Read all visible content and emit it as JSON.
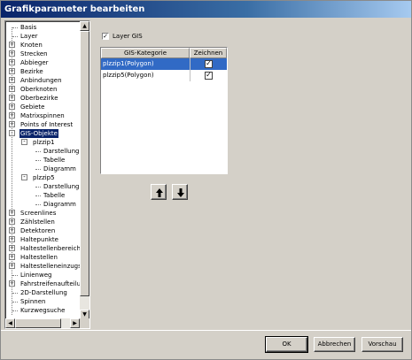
{
  "window": {
    "title": "Grafikparameter bearbeiten"
  },
  "tree": {
    "items": [
      {
        "label": "Basis",
        "level": 0,
        "toggle": ""
      },
      {
        "label": "Layer",
        "level": 0,
        "toggle": ""
      },
      {
        "label": "Knoten",
        "level": 0,
        "toggle": "+"
      },
      {
        "label": "Strecken",
        "level": 0,
        "toggle": "+"
      },
      {
        "label": "Abbieger",
        "level": 0,
        "toggle": "+"
      },
      {
        "label": "Bezirke",
        "level": 0,
        "toggle": "+"
      },
      {
        "label": "Anbindungen",
        "level": 0,
        "toggle": "+"
      },
      {
        "label": "Oberknoten",
        "level": 0,
        "toggle": "+"
      },
      {
        "label": "Oberbezirke",
        "level": 0,
        "toggle": "+"
      },
      {
        "label": "Gebiete",
        "level": 0,
        "toggle": "+"
      },
      {
        "label": "Matrixspinnen",
        "level": 0,
        "toggle": "+"
      },
      {
        "label": "Points of Interest",
        "level": 0,
        "toggle": "+"
      },
      {
        "label": "GIS-Objekte",
        "level": 0,
        "toggle": "-",
        "selected": true
      },
      {
        "label": "plzzip1",
        "level": 1,
        "toggle": "-"
      },
      {
        "label": "Darstellung",
        "level": 2,
        "toggle": ""
      },
      {
        "label": "Tabelle",
        "level": 2,
        "toggle": ""
      },
      {
        "label": "Diagramm",
        "level": 2,
        "toggle": ""
      },
      {
        "label": "plzzip5",
        "level": 1,
        "toggle": "-"
      },
      {
        "label": "Darstellung",
        "level": 2,
        "toggle": ""
      },
      {
        "label": "Tabelle",
        "level": 2,
        "toggle": ""
      },
      {
        "label": "Diagramm",
        "level": 2,
        "toggle": ""
      },
      {
        "label": "Screenlines",
        "level": 0,
        "toggle": "+"
      },
      {
        "label": "Zählstellen",
        "level": 0,
        "toggle": "+"
      },
      {
        "label": "Detektoren",
        "level": 0,
        "toggle": "+"
      },
      {
        "label": "Haltepunkte",
        "level": 0,
        "toggle": "+"
      },
      {
        "label": "Haltestellenbereiche",
        "level": 0,
        "toggle": "+"
      },
      {
        "label": "Haltestellen",
        "level": 0,
        "toggle": "+"
      },
      {
        "label": "Haltestelleneinzugsge",
        "level": 0,
        "toggle": "+"
      },
      {
        "label": "Linienweg",
        "level": 0,
        "toggle": ""
      },
      {
        "label": "Fahrstreifenaufteilung",
        "level": 0,
        "toggle": "+"
      },
      {
        "label": "2D-Darstellung",
        "level": 0,
        "toggle": ""
      },
      {
        "label": "Spinnen",
        "level": 0,
        "toggle": ""
      },
      {
        "label": "Kurzwegsuche",
        "level": 0,
        "toggle": ""
      }
    ]
  },
  "layer": {
    "label": "Layer GIS",
    "checked": true
  },
  "grid": {
    "headers": [
      "GIS-Kategorie",
      "Zeichnen"
    ],
    "rows": [
      {
        "kategorie": "plzzip1(Polygon)",
        "zeichnen": true,
        "selected": true
      },
      {
        "kategorie": "plzzip5(Polygon)",
        "zeichnen": true,
        "selected": false
      }
    ]
  },
  "icons": {
    "up": "arrow-up-icon",
    "down": "arrow-down-icon"
  },
  "buttons": {
    "ok": "OK",
    "cancel": "Abbrechen",
    "preview": "Vorschau"
  },
  "colors": {
    "title_start": "#0a246a",
    "selection": "#316ac5",
    "tree_selection": "#0a246a",
    "face": "#d4d0c8"
  }
}
